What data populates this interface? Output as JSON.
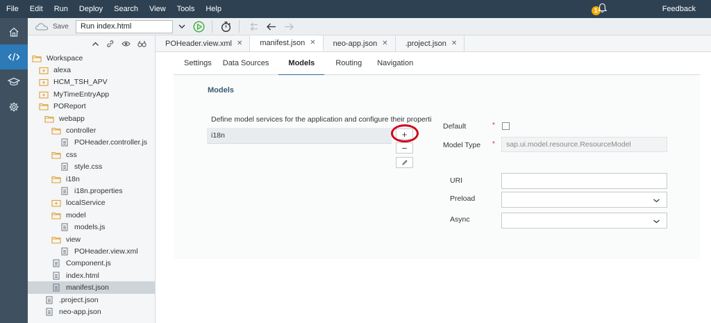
{
  "menu": {
    "items": [
      "File",
      "Edit",
      "Run",
      "Deploy",
      "Search",
      "View",
      "Tools",
      "Help"
    ],
    "notifications_count": "1",
    "feedback": "Feedback"
  },
  "toolbar": {
    "save_label": "Save",
    "run_config": "Run index.html"
  },
  "rail": {
    "icons": [
      "home-icon",
      "code-icon",
      "learn-icon",
      "settings-icon"
    ]
  },
  "tree": {
    "items": [
      {
        "label": "Workspace",
        "type": "folder",
        "level": 0
      },
      {
        "label": "alexa",
        "type": "project",
        "level": 1
      },
      {
        "label": "HCM_TSH_APV",
        "type": "project",
        "level": 1
      },
      {
        "label": "MyTimeEntryApp",
        "type": "project",
        "level": 1
      },
      {
        "label": "POReport",
        "type": "folder",
        "level": 1
      },
      {
        "label": "webapp",
        "type": "folder",
        "level": 2
      },
      {
        "label": "controller",
        "type": "folder",
        "level": 3
      },
      {
        "label": "POHeader.controller.js",
        "type": "file",
        "level": 4
      },
      {
        "label": "css",
        "type": "folder",
        "level": 3
      },
      {
        "label": "style.css",
        "type": "file",
        "level": 4
      },
      {
        "label": "i18n",
        "type": "folder",
        "level": 3
      },
      {
        "label": "i18n.properties",
        "type": "file",
        "level": 4
      },
      {
        "label": "localService",
        "type": "project",
        "level": 3
      },
      {
        "label": "model",
        "type": "folder",
        "level": 3
      },
      {
        "label": "models.js",
        "type": "file",
        "level": 4
      },
      {
        "label": "view",
        "type": "folder",
        "level": 3
      },
      {
        "label": "POHeader.view.xml",
        "type": "file",
        "level": 4
      },
      {
        "label": "Component.js",
        "type": "file",
        "level": 3
      },
      {
        "label": "index.html",
        "type": "file",
        "level": 3
      },
      {
        "label": "manifest.json",
        "type": "file",
        "level": 3,
        "selected": true
      },
      {
        "label": ".project.json",
        "type": "file",
        "level": 2
      },
      {
        "label": "neo-app.json",
        "type": "file",
        "level": 2
      }
    ]
  },
  "tabs": [
    {
      "label": "POHeader.view.xml",
      "active": false
    },
    {
      "label": "manifest.json",
      "active": true
    },
    {
      "label": "neo-app.json",
      "active": false
    },
    {
      "label": ".project.json",
      "active": false
    }
  ],
  "subtabs": [
    {
      "label": "Settings",
      "active": false
    },
    {
      "label": "Data Sources",
      "active": false
    },
    {
      "label": "Models",
      "active": true
    },
    {
      "label": "Routing",
      "active": false
    },
    {
      "label": "Navigation",
      "active": false
    }
  ],
  "models": {
    "title": "Models",
    "description": "Define model services for the application and configure their properti...",
    "list": [
      "i18n"
    ],
    "add": "+",
    "remove": "−"
  },
  "form": {
    "default_label": "Default",
    "model_type_label": "Model Type",
    "model_type_value": "sap.ui.model.resource.ResourceModel",
    "required_mark": "*",
    "uri_label": "URI",
    "preload_label": "Preload",
    "async_label": "Async"
  },
  "colors": {
    "menubar": "#2e4152",
    "rail": "#3f5161",
    "rail_active": "#2c7ab7",
    "annotation": "#d0021b"
  }
}
